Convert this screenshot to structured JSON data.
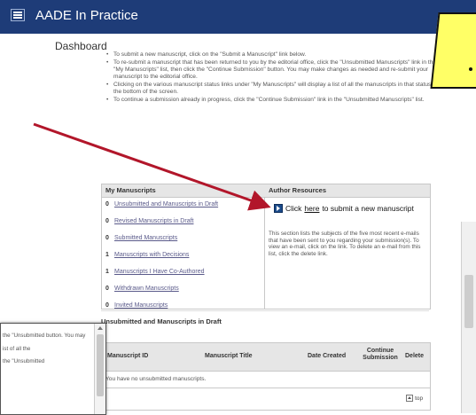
{
  "header": {
    "title": "AADE In Practice"
  },
  "dashboard": {
    "title": "Dashboard",
    "instructions": [
      "To submit a new manuscript, click on the \"Submit a Manuscript\" link below.",
      "To re-submit a manuscript that has been returned to you by the editorial office, click the \"Unsubmitted Manuscripts\" link in the \"My Manuscripts\" list, then click the \"Continue Submission\" button. You may make changes as needed and re-submit your manuscript to the editorial office.",
      "Clicking on the various manuscript status links under \"My Manuscripts\" will display a list of all the manuscripts in that status at the bottom of the screen.",
      "To continue a submission already in progress, click the \"Continue Submission\" link in the \"Unsubmitted Manuscripts\" list."
    ]
  },
  "my_manuscripts": {
    "heading": "My Manuscripts",
    "items": [
      {
        "count": "0",
        "label": "Unsubmitted and Manuscripts in Draft"
      },
      {
        "count": "0",
        "label": "Revised Manuscripts in Draft"
      },
      {
        "count": "0",
        "label": "Submitted Manuscripts"
      },
      {
        "count": "1",
        "label": "Manuscripts with Decisions"
      },
      {
        "count": "1",
        "label": "Manuscripts I Have Co-Authored"
      },
      {
        "count": "0",
        "label": "Withdrawn Manuscripts"
      },
      {
        "count": "0",
        "label": "Invited Manuscripts"
      }
    ]
  },
  "author_resources": {
    "heading": "Author Resources",
    "click": "Click",
    "here": "here",
    "submit_text": "to submit a new manuscript",
    "description": "This section lists the subjects of the five most recent e-mails that have been sent to you regarding your submission(s). To view an e-mail, click on the link. To delete an e-mail from this list, click the delete link."
  },
  "unsubmitted": {
    "heading": "Unsubmitted and Manuscripts in Draft",
    "columns": [
      "Manuscript ID",
      "Manuscript Title",
      "Date Created",
      "Continue Submission",
      "Delete"
    ],
    "empty_message": "You have no unsubmitted manuscripts.",
    "top_label": "top"
  },
  "inset": {
    "lines": [
      "the \"Unsubmitted button. You may",
      "ist of all the",
      "the \"Unsubmitted"
    ]
  },
  "colors": {
    "header_bg": "#1e3c78",
    "annotation_arrow": "#b2162a",
    "callout": "#ffff66"
  }
}
